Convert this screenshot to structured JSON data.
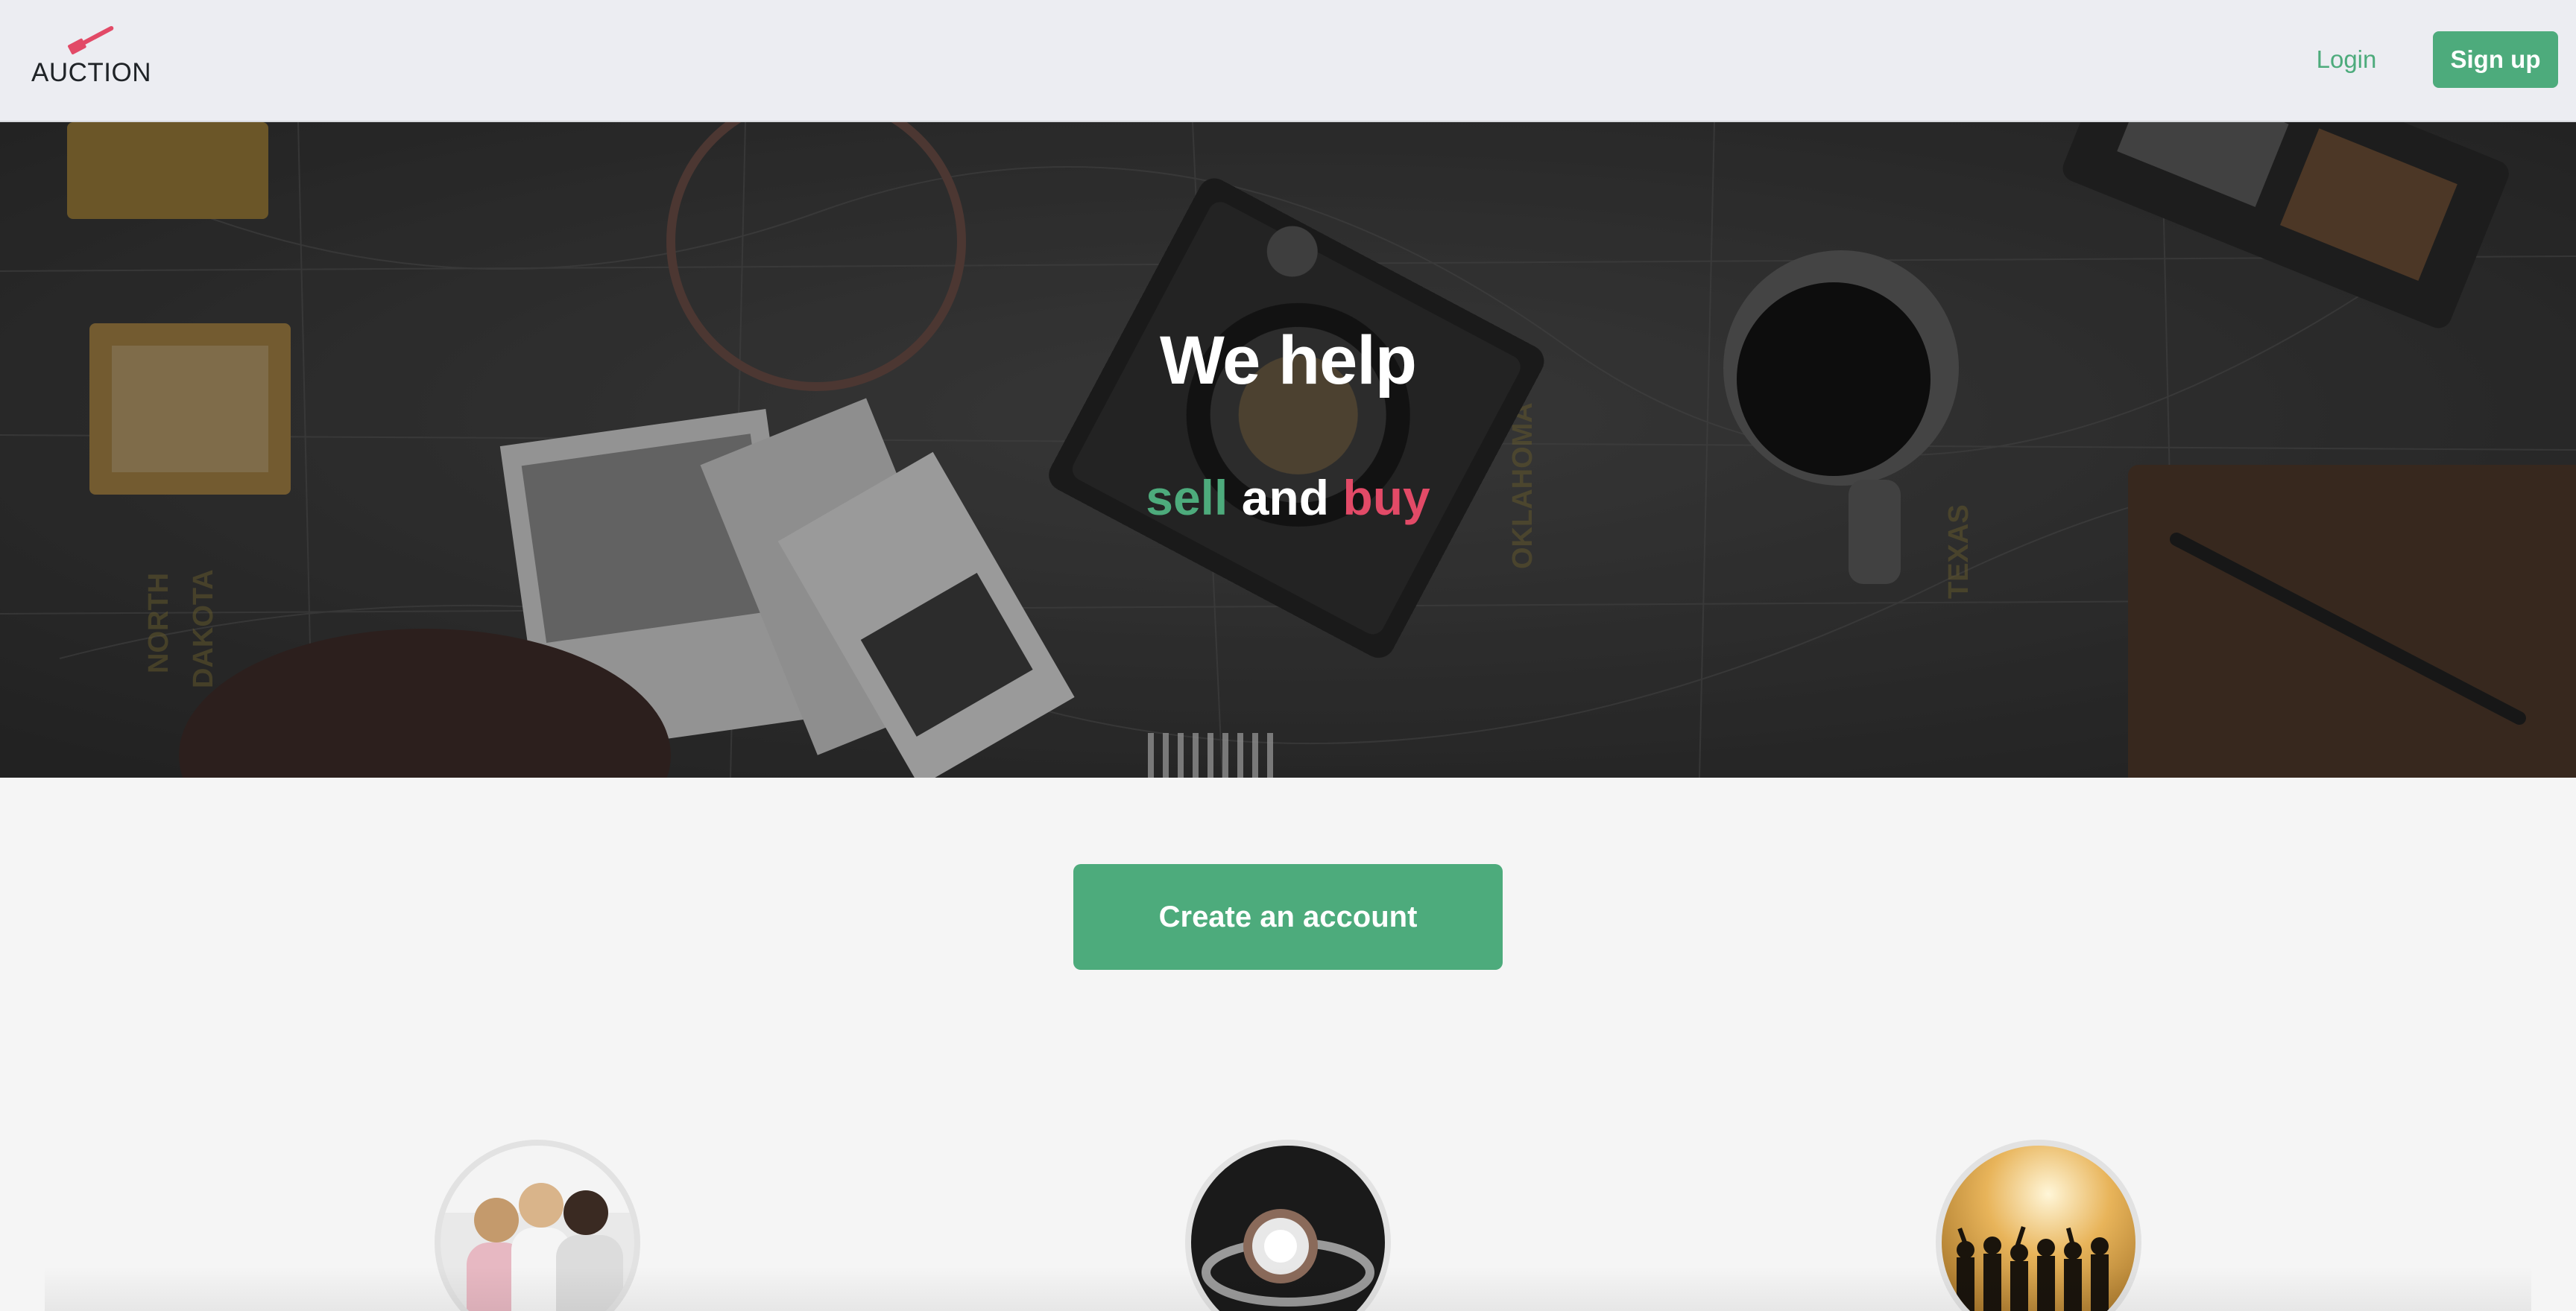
{
  "header": {
    "logo_text": "AUCTION",
    "logo_icon": "gavel-icon",
    "login_label": "Login",
    "signup_label": "Sign up"
  },
  "hero": {
    "title": "We help",
    "subtitle": {
      "sell": "sell",
      "and": "and",
      "buy": "buy"
    }
  },
  "cta": {
    "label": "Create an account"
  },
  "features": [
    {
      "image": "friends-shopping-photo"
    },
    {
      "image": "diamond-ring-photo"
    },
    {
      "image": "group-silhouette-sunset-photo"
    }
  ],
  "colors": {
    "accent_green": "#4dab7c",
    "accent_red": "#e24a67",
    "header_bg": "#ecedf2",
    "page_bg": "#f5f5f5"
  }
}
